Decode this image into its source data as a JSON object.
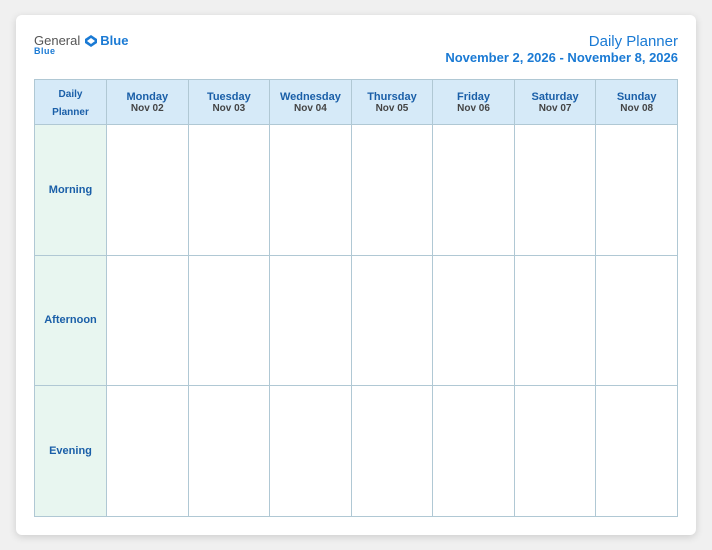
{
  "header": {
    "logo": {
      "general": "General",
      "blue": "Blue",
      "sub": "Blue"
    },
    "title": "Daily Planner",
    "date_range": "November 2, 2026 - November 8, 2026"
  },
  "table": {
    "first_col_header_line1": "Daily",
    "first_col_header_line2": "Planner",
    "days": [
      {
        "name": "Monday",
        "date": "Nov 02"
      },
      {
        "name": "Tuesday",
        "date": "Nov 03"
      },
      {
        "name": "Wednesday",
        "date": "Nov 04"
      },
      {
        "name": "Thursday",
        "date": "Nov 05"
      },
      {
        "name": "Friday",
        "date": "Nov 06"
      },
      {
        "name": "Saturday",
        "date": "Nov 07"
      },
      {
        "name": "Sunday",
        "date": "Nov 08"
      }
    ],
    "rows": [
      {
        "label": "Morning"
      },
      {
        "label": "Afternoon"
      },
      {
        "label": "Evening"
      }
    ]
  }
}
